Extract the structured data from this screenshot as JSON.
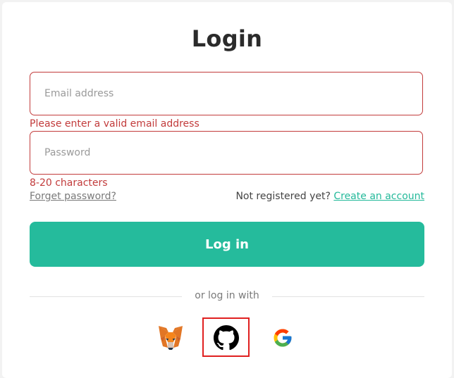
{
  "login": {
    "title": "Login",
    "email": {
      "placeholder": "Email address",
      "error": "Please enter a valid email address"
    },
    "password": {
      "placeholder": "Password",
      "error": "8-20 characters"
    },
    "forget_link": "Forget password?",
    "register_prompt": "Not registered yet?",
    "create_account_link": "Create an account",
    "login_button": "Log in",
    "divider_text": "or log in with",
    "social": [
      {
        "name": "metamask",
        "icon": "metamask-fox-icon"
      },
      {
        "name": "github",
        "icon": "github-icon"
      },
      {
        "name": "google",
        "icon": "google-icon"
      }
    ],
    "colors": {
      "accent": "#25bb9c",
      "error": "#c23b3b",
      "highlight_box": "#e02020"
    }
  }
}
